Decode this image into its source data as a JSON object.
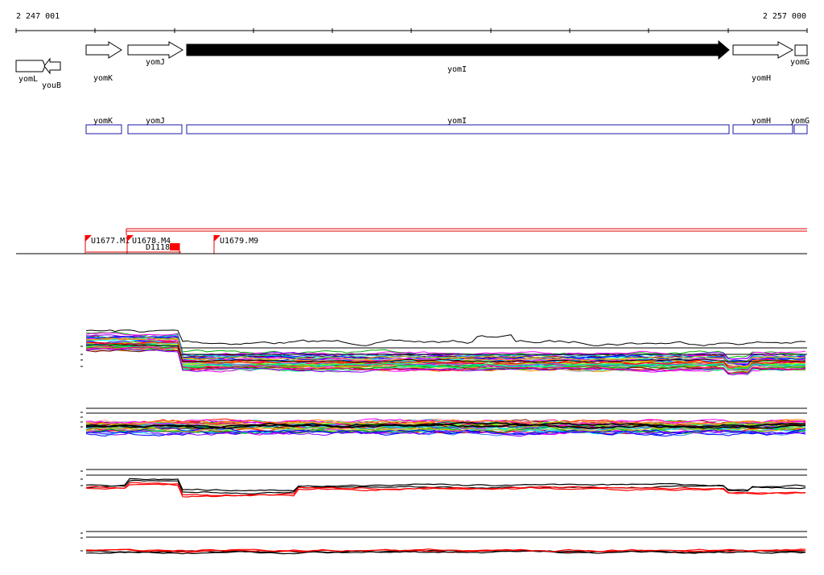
{
  "ruler": {
    "start_label": "2 247 001",
    "end_label": "2 257 000"
  },
  "genes": [
    {
      "name": "yomL",
      "strand": "+",
      "highlight": false
    },
    {
      "name": "youB",
      "strand": "-",
      "highlight": false
    },
    {
      "name": "yomK",
      "strand": "+",
      "highlight": false
    },
    {
      "name": "yomJ",
      "strand": "+",
      "highlight": false
    },
    {
      "name": "yomI",
      "strand": "+",
      "highlight": true
    },
    {
      "name": "yomH",
      "strand": "+",
      "highlight": false
    },
    {
      "name": "yomG",
      "strand": "+",
      "highlight": false
    }
  ],
  "transcripts": [
    "yomK",
    "yomJ",
    "yomI",
    "yomH",
    "yomG"
  ],
  "markers": [
    {
      "label": "U1677.M1"
    },
    {
      "label": "U1678.M4"
    },
    {
      "label": "D1118"
    },
    {
      "label": "U1679.M9"
    }
  ],
  "colors": {
    "gene_fill": "#ffffff",
    "gene_highlight": "#000000",
    "transcript_box": "#1a1aa6",
    "marker": "#ff0000"
  }
}
